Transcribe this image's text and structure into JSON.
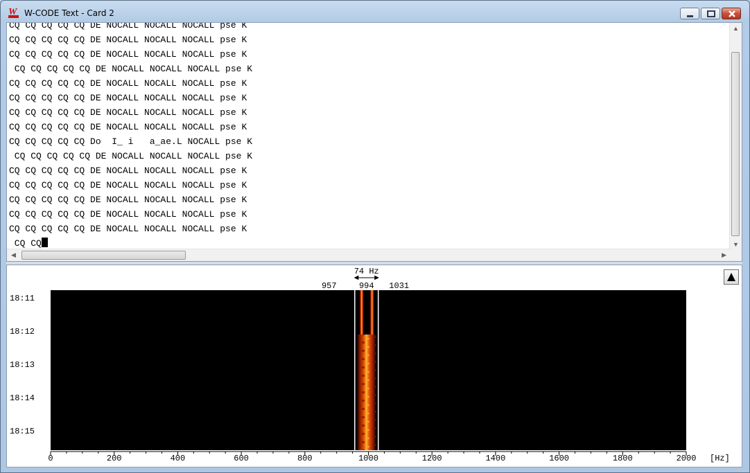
{
  "window": {
    "title": "W-CODE Text  - Card 2",
    "icon_text": "W"
  },
  "textpane": {
    "lines": [
      "CQ CQ CQ CQ CQ DE NOCALL NOCALL NOCALL pse K",
      "CQ CQ CQ CQ CQ DE NOCALL NOCALL NOCALL pse K",
      "CQ CQ CQ CQ CQ DE NOCALL NOCALL NOCALL pse K",
      " CQ CQ CQ CQ CQ DE NOCALL NOCALL NOCALL pse K",
      "CQ CQ CQ CQ CQ DE NOCALL NOCALL NOCALL pse K",
      "CQ CQ CQ CQ CQ DE NOCALL NOCALL NOCALL pse K",
      "CQ CQ CQ CQ CQ DE NOCALL NOCALL NOCALL pse K",
      "CQ CQ CQ CQ CQ DE NOCALL NOCALL NOCALL pse K",
      "CQ CQ CQ CQ CQ Do  I_ i   a_ae.L NOCALL pse K",
      " CQ CQ CQ CQ CQ DE NOCALL NOCALL NOCALL pse K",
      "CQ CQ CQ CQ CQ DE NOCALL NOCALL NOCALL pse K",
      "CQ CQ CQ CQ CQ DE NOCALL NOCALL NOCALL pse K",
      "CQ CQ CQ CQ CQ DE NOCALL NOCALL NOCALL pse K",
      "CQ CQ CQ CQ CQ DE NOCALL NOCALL NOCALL pse K",
      "CQ CQ CQ CQ CQ DE NOCALL NOCALL NOCALL pse K",
      " CQ CQ"
    ]
  },
  "waterfall": {
    "bandwidth_label": "74 Hz",
    "marker_low": "957",
    "marker_center": "994",
    "marker_high": "1031",
    "time_labels": [
      "18:11",
      "18:12",
      "18:13",
      "18:14",
      "18:15"
    ],
    "freq_ticks": [
      "0",
      "200",
      "400",
      "600",
      "800",
      "1000",
      "1200",
      "1400",
      "1600",
      "1800",
      "2000"
    ],
    "unit_label": "[Hz]",
    "freq_min": 0,
    "freq_max": 2000,
    "signal_low_hz": 957,
    "signal_high_hz": 1031,
    "signal_center_hz": 994
  },
  "colors": {
    "waterfall_bg": "#000000",
    "signal_core": "#ff9a1a",
    "signal_edge": "#c02800",
    "marker_line": "#ffffff"
  }
}
